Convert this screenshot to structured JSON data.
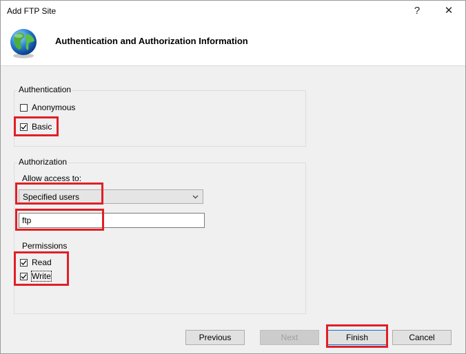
{
  "window": {
    "title": "Add FTP Site",
    "help_glyph": "?",
    "close_glyph": "✕"
  },
  "header": {
    "title": "Authentication and Authorization Information",
    "icon": "globe-icon"
  },
  "authentication": {
    "legend": "Authentication",
    "anonymous": {
      "label": "Anonymous",
      "checked": false
    },
    "basic": {
      "label": "Basic",
      "checked": true
    }
  },
  "authorization": {
    "legend": "Authorization",
    "allow_access_label": "Allow access to:",
    "access_selected": "Specified users",
    "users_value": "ftp",
    "permissions_label": "Permissions",
    "read": {
      "label": "Read",
      "checked": true
    },
    "write": {
      "label": "Write",
      "checked": true
    }
  },
  "buttons": {
    "previous": "Previous",
    "next": "Next",
    "finish": "Finish",
    "cancel": "Cancel"
  },
  "colors": {
    "highlight": "#e01f26",
    "dialog_bg": "#f0f0f0",
    "focus_border": "#0078d7"
  }
}
